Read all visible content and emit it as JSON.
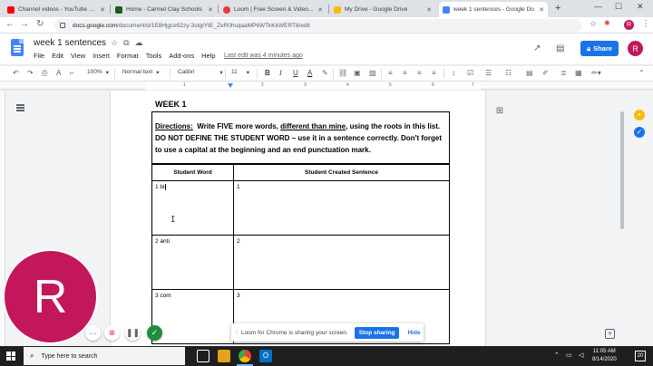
{
  "browser": {
    "tabs": [
      {
        "label": "Channel videos - YouTube Studio",
        "favicon_color": "#ff0000"
      },
      {
        "label": "Home - Carmel Clay Schools",
        "favicon_color": "#1b5e20"
      },
      {
        "label": "Loom | Free Screen & Video Re",
        "favicon_color": "#e53935"
      },
      {
        "label": "My Drive - Google Drive",
        "favicon_color": "#fbbc04"
      },
      {
        "label": "week 1 sentences - Google Do",
        "favicon_color": "#4285f4"
      }
    ],
    "url_host": "docs.google.com",
    "url_path": "/document/d/1E8Hjgce92zy-3stgIYtE_ZeR0hsqaaMP6WTkKkWERT8/edit"
  },
  "docs": {
    "title": "week 1 sentences",
    "menu": [
      "File",
      "Edit",
      "View",
      "Insert",
      "Format",
      "Tools",
      "Add-ons",
      "Help"
    ],
    "last_edit": "Last edit was 4 minutes ago",
    "share_label": "Share",
    "avatar_letter": "R"
  },
  "toolbar": {
    "zoom": "100%",
    "style": "Normal text",
    "font": "Calibri",
    "size": "11"
  },
  "ruler_numbers": [
    "1",
    "2",
    "3",
    "4",
    "5",
    "6",
    "7"
  ],
  "content": {
    "heading": "WEEK 1",
    "directions_label": "Directions:",
    "directions_1": "Write FIVE more words, ",
    "directions_underlined": "different than mine",
    "directions_2": ", using the roots in this list. DO NOT DEFINE THE STUDENT WORD – use it in a sentence correctly. Don't forget to use a capital at the beginning and an end punctuation mark.",
    "table": {
      "headers": [
        "Student Word",
        "Student Created Sentence"
      ],
      "rows": [
        {
          "word": "1 bi",
          "sentence": "1"
        },
        {
          "word": "2 anti",
          "sentence": "2"
        },
        {
          "word": "3 com",
          "sentence": "3"
        }
      ]
    }
  },
  "loom": {
    "avatar_letter": "R",
    "avatar_color": "#c2185b",
    "sharing_text": "Loom for Chrome is sharing your screen.",
    "stop_label": "Stop sharing",
    "hide_label": "Hide"
  },
  "taskbar": {
    "search_placeholder": "Type here to search",
    "time": "11:05 AM",
    "date": "8/14/2020",
    "notifications": "20"
  }
}
